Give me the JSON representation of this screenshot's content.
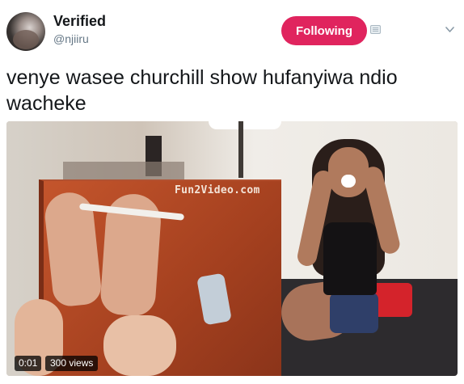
{
  "user": {
    "name": "Verified",
    "handle": "@njiiru"
  },
  "follow_button": {
    "label": "Following",
    "color": "#e0245e"
  },
  "icons": {
    "card": "profile-card-icon",
    "menu": "chevron-down-icon"
  },
  "tweet": {
    "text": "venye wasee churchill show hufanyiwa ndio wacheke"
  },
  "media": {
    "watermark": "Fun2Video.com",
    "duration": "0:01",
    "views": "300 views"
  }
}
